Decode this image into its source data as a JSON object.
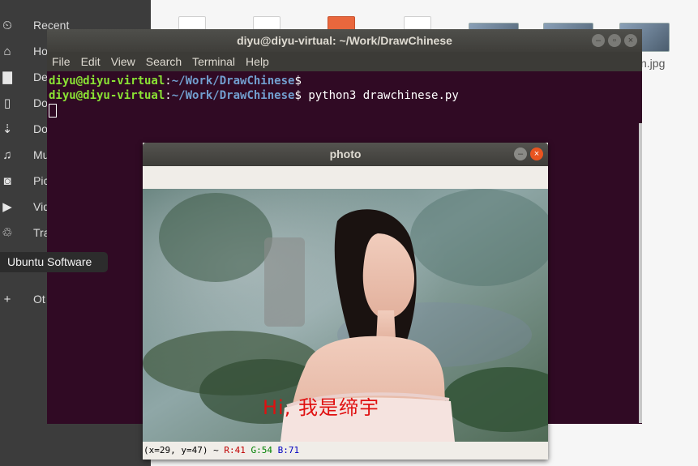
{
  "file_manager": {
    "places": [
      {
        "label": "Recent",
        "icon": "clock-icon",
        "glyph": "⏲"
      },
      {
        "label": "Ho",
        "icon": "home-icon",
        "glyph": "⌂"
      },
      {
        "label": "De",
        "icon": "folder-icon",
        "glyph": "▇"
      },
      {
        "label": "Do",
        "icon": "document-icon",
        "glyph": "▯"
      },
      {
        "label": "Do",
        "icon": "download-icon",
        "glyph": "⇣"
      },
      {
        "label": "Mu",
        "icon": "music-icon",
        "glyph": "♫"
      },
      {
        "label": "Pic",
        "icon": "camera-icon",
        "glyph": "◙"
      },
      {
        "label": "Vid",
        "icon": "video-icon",
        "glyph": "▶"
      },
      {
        "label": "Tra",
        "icon": "trash-icon",
        "glyph": "♲"
      },
      {
        "label": "Ot",
        "icon": "plus-icon",
        "glyph": "+"
      }
    ],
    "file_label": "n.jpg"
  },
  "dock": {
    "tooltip": "Ubuntu Software"
  },
  "terminal": {
    "title": "diyu@diyu-virtual: ~/Work/DrawChinese",
    "menu": [
      "File",
      "Edit",
      "View",
      "Search",
      "Terminal",
      "Help"
    ],
    "lines": [
      {
        "user": "diyu@diyu-virtual",
        "sep": ":",
        "path": "~/Work/DrawChinese",
        "prompt": "$",
        "command": ""
      },
      {
        "user": "diyu@diyu-virtual",
        "sep": ":",
        "path": "~/Work/DrawChinese",
        "prompt": "$",
        "command": " python3 drawchinese.py"
      }
    ]
  },
  "photo_window": {
    "title": "photo",
    "overlay_text": "Hi, 我是缔宇",
    "status": {
      "coords": "(x=29, y=47) ~",
      "r": "R:41",
      "g": "G:54",
      "b": "B:71"
    }
  }
}
